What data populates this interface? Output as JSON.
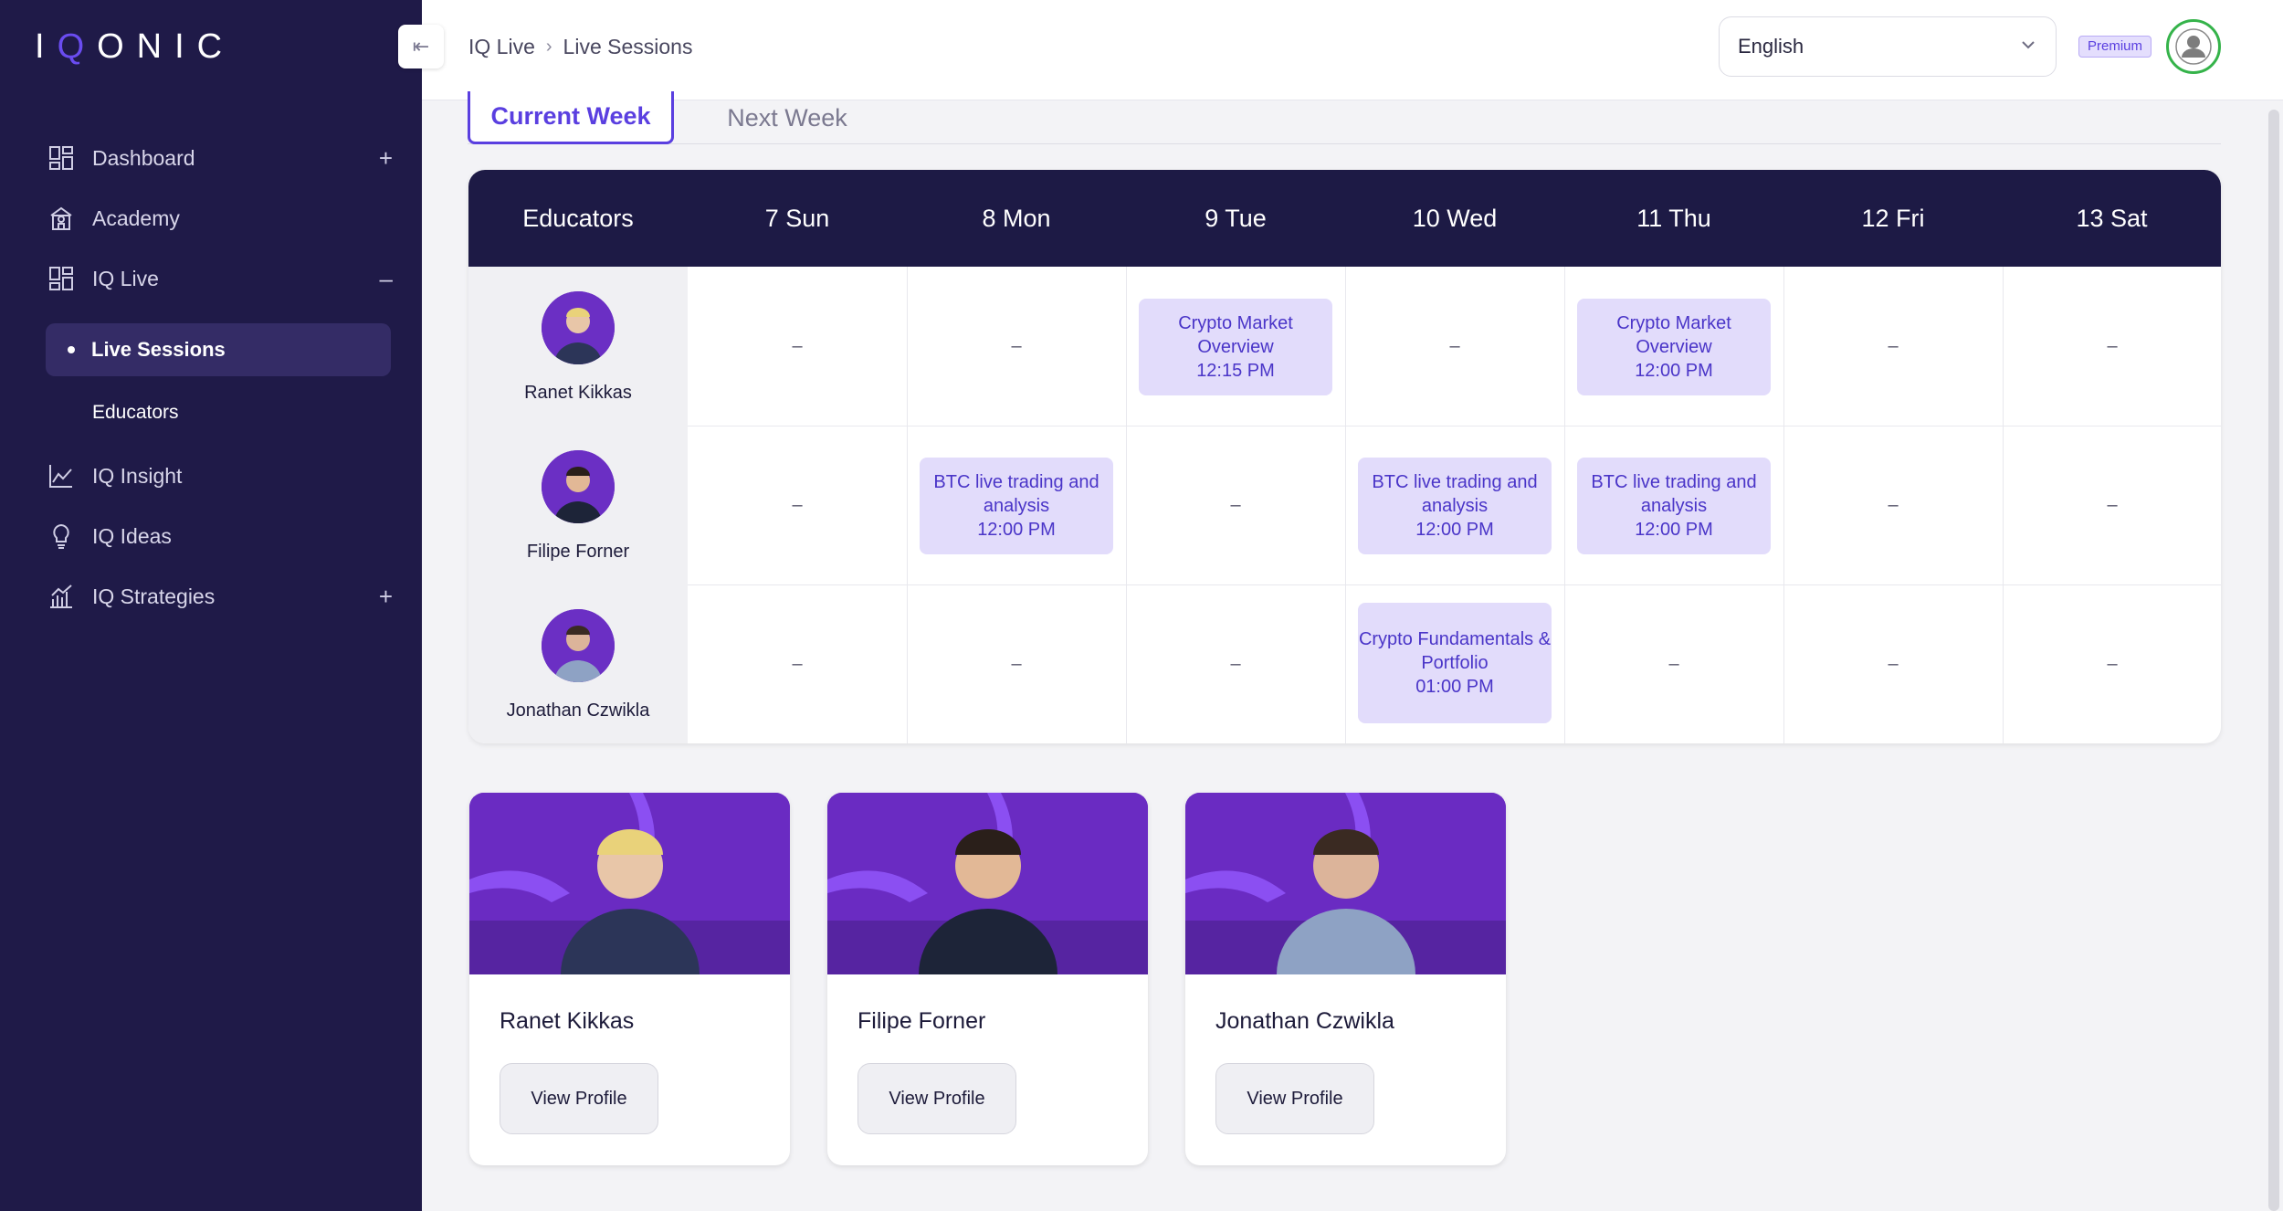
{
  "brand": {
    "logo_pre": "I",
    "logo_q": "Q",
    "logo_post": "ONIC"
  },
  "sidebar": {
    "items": [
      {
        "label": "Dashboard",
        "icon": "grid-icon",
        "toggle": "+"
      },
      {
        "label": "Academy",
        "icon": "building-icon",
        "toggle": ""
      },
      {
        "label": "IQ Live",
        "icon": "grid-icon",
        "toggle": "–"
      },
      {
        "label": "IQ Insight",
        "icon": "line-chart-icon",
        "toggle": ""
      },
      {
        "label": "IQ Ideas",
        "icon": "lightbulb-icon",
        "toggle": ""
      },
      {
        "label": "IQ Strategies",
        "icon": "bar-chart-icon",
        "toggle": "+"
      }
    ],
    "sub_active": "Live Sessions",
    "sub_item": "Educators"
  },
  "header": {
    "breadcrumb": [
      "IQ Live",
      "Live Sessions"
    ],
    "language": "English",
    "badge": "Premium"
  },
  "tabs": {
    "current": "Current Week",
    "next": "Next Week"
  },
  "schedule": {
    "columns": [
      "Educators",
      "7 Sun",
      "8 Mon",
      "9 Tue",
      "10 Wed",
      "11 Thu",
      "12 Fri",
      "13 Sat"
    ],
    "empty": "–",
    "rows": [
      {
        "educator": "Ranet Kikkas",
        "cells": [
          null,
          null,
          {
            "title": "Crypto Market Overview",
            "time": "12:15 PM"
          },
          null,
          {
            "title": "Crypto Market Overview",
            "time": "12:00 PM"
          },
          null,
          null
        ]
      },
      {
        "educator": "Filipe Forner",
        "cells": [
          null,
          {
            "title": "BTC live trading and analysis",
            "time": "12:00 PM"
          },
          null,
          {
            "title": "BTC live trading and analysis",
            "time": "12:00 PM"
          },
          {
            "title": "BTC live trading and analysis",
            "time": "12:00 PM"
          },
          null,
          null
        ]
      },
      {
        "educator": "Jonathan Czwikla",
        "cells": [
          null,
          null,
          null,
          {
            "title": "Crypto Fundamentals & Portfolio",
            "time": "01:00 PM"
          },
          null,
          null,
          null
        ]
      }
    ]
  },
  "cards": [
    {
      "name": "Ranet Kikkas",
      "button": "View Profile"
    },
    {
      "name": "Filipe Forner",
      "button": "View Profile"
    },
    {
      "name": "Jonathan Czwikla",
      "button": "View Profile"
    }
  ],
  "colors": {
    "sidebar": "#1f1a48",
    "accent": "#5a3fe0",
    "session_bg": "#e2dcfb",
    "table_head": "#1d1a45"
  }
}
